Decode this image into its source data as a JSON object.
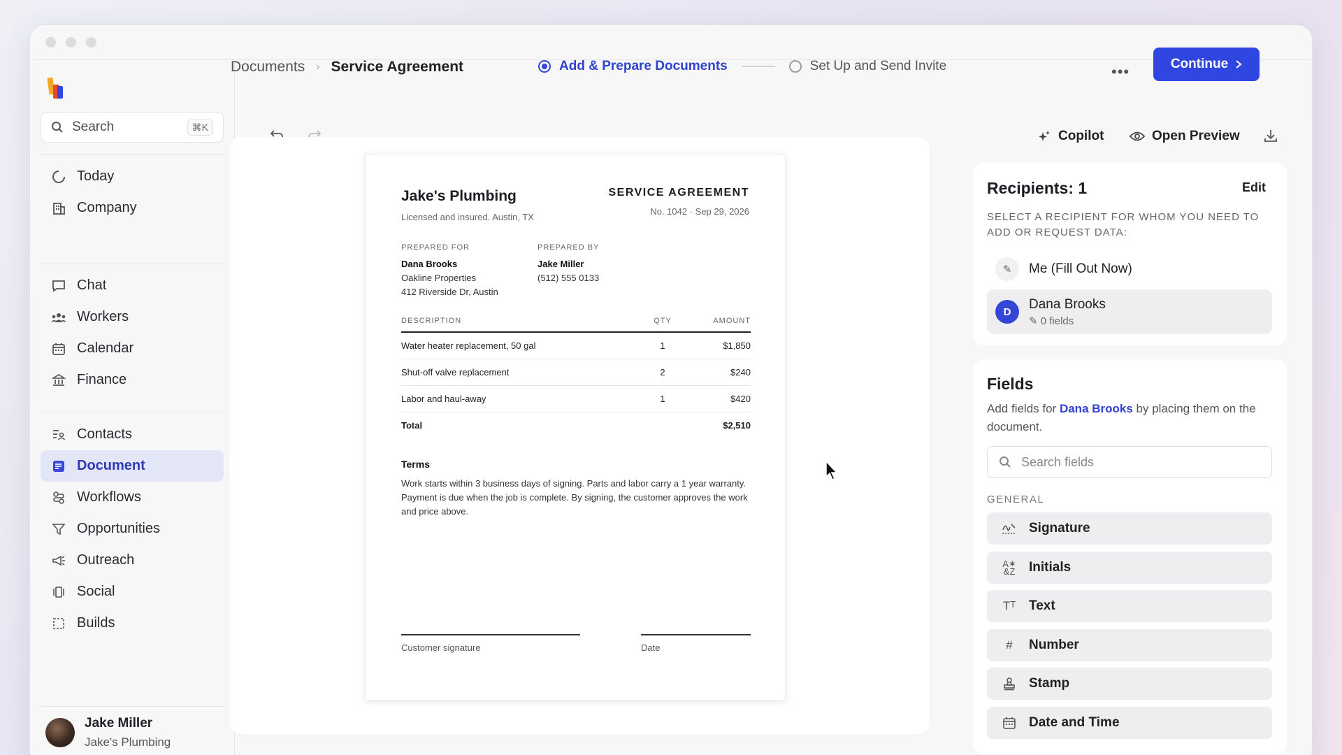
{
  "sidebar": {
    "search_label": "Search",
    "search_shortcut": "⌘K",
    "groups": [
      [
        {
          "label": "Today",
          "icon": "today-icon"
        },
        {
          "label": "Company",
          "icon": "building-icon"
        }
      ],
      [
        {
          "label": "Chat",
          "icon": "chat-icon"
        },
        {
          "label": "Workers",
          "icon": "workers-icon"
        },
        {
          "label": "Calendar",
          "icon": "calendar-icon"
        },
        {
          "label": "Finance",
          "icon": "bank-icon"
        }
      ],
      [
        {
          "label": "Contacts",
          "icon": "contacts-icon"
        },
        {
          "label": "Document",
          "icon": "document-icon",
          "active": true
        },
        {
          "label": "Workflows",
          "icon": "workflows-icon"
        },
        {
          "label": "Opportunities",
          "icon": "funnel-icon"
        },
        {
          "label": "Outreach",
          "icon": "megaphone-icon"
        },
        {
          "label": "Social",
          "icon": "social-icon"
        },
        {
          "label": "Builds",
          "icon": "builds-icon"
        }
      ]
    ],
    "user": {
      "name": "Jake Miller",
      "company": "Jake's Plumbing"
    }
  },
  "header": {
    "breadcrumb_root": "Documents",
    "breadcrumb_current": "Service Agreement",
    "step1": "Add & Prepare Documents",
    "step2": "Set Up and Send Invite",
    "continue_label": "Continue"
  },
  "toolbar": {
    "copilot_label": "Copilot",
    "preview_label": "Open Preview"
  },
  "document": {
    "business_name": "Jake's Plumbing",
    "business_sub": "Licensed and insured. Austin, TX",
    "doc_title": "SERVICE AGREEMENT",
    "doc_number": "No. 1042 · Sep 29, 2026",
    "prepared_for_h": "PREPARED FOR",
    "prepared_for_name": "Dana Brooks",
    "prepared_for_company": "Oakline Properties",
    "prepared_for_address": "412 Riverside Dr, Austin",
    "prepared_by_h": "PREPARED BY",
    "prepared_by_name": "Jake Miller",
    "prepared_by_phone": "(512) 555 0133",
    "col_desc": "DESCRIPTION",
    "col_qty": "QTY",
    "col_amount": "AMOUNT",
    "items": [
      {
        "desc": "Water heater replacement, 50 gal",
        "qty": "1",
        "amount": "$1,850"
      },
      {
        "desc": "Shut-off valve replacement",
        "qty": "2",
        "amount": "$240"
      },
      {
        "desc": "Labor and haul-away",
        "qty": "1",
        "amount": "$420"
      }
    ],
    "total_label": "Total",
    "total_amount": "$2,510",
    "terms_h": "Terms",
    "terms": "Work starts within 3 business days of signing. Parts and labor carry a 1 year warranty. Payment is due when the job is complete. By signing, the customer approves the work and price above.",
    "sig_label": "Customer signature",
    "date_label": "Date"
  },
  "recipients": {
    "title": "Recipients: 1",
    "edit_label": "Edit",
    "subtitle": "SELECT A RECIPIENT FOR WHOM YOU NEED TO ADD OR REQUEST DATA:",
    "me_label": "Me (Fill Out Now)",
    "recipient_initial": "D",
    "recipient_name": "Dana Brooks",
    "recipient_fields": "0 fields"
  },
  "fields": {
    "title": "Fields",
    "desc_prefix": "Add fields for ",
    "desc_name": "Dana Brooks",
    "desc_suffix": " by placing them on the document.",
    "search_placeholder": "Search fields",
    "group_label": "GENERAL",
    "items": [
      {
        "label": "Signature",
        "icon": "signature-icon"
      },
      {
        "label": "Initials",
        "icon": "initials-icon"
      },
      {
        "label": "Text",
        "icon": "text-icon"
      },
      {
        "label": "Number",
        "icon": "hash-icon"
      },
      {
        "label": "Stamp",
        "icon": "stamp-icon"
      },
      {
        "label": "Date and Time",
        "icon": "calendar-icon"
      }
    ]
  },
  "colors": {
    "accent": "#2f46e0",
    "active_bg": "#e3e6f7"
  }
}
